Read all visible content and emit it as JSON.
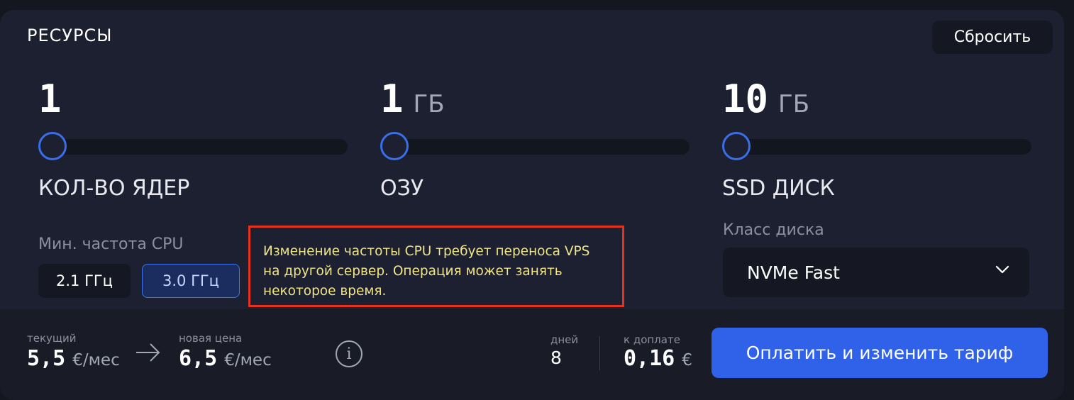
{
  "header": {
    "title": "РЕСУРСЫ",
    "reset_label": "Сбросить"
  },
  "resources": [
    {
      "value": "1",
      "unit": "",
      "label": "КОЛ-ВО ЯДЕР",
      "slider_fraction": 0
    },
    {
      "value": "1",
      "unit": "ГБ",
      "label": "ОЗУ",
      "slider_fraction": 0
    },
    {
      "value": "10",
      "unit": "ГБ",
      "label": "SSD ДИСК",
      "slider_fraction": 0
    }
  ],
  "cpu": {
    "label": "Мин. частота CPU",
    "options": [
      "2.1 ГГц",
      "3.0 ГГц"
    ],
    "selected": "3.0 ГГц"
  },
  "tooltip": {
    "text": "Изменение частоты CPU требует переноса VPS на другой сервер. Операция может занять некоторое время."
  },
  "disk": {
    "label": "Класс диска",
    "selected": "NVMe Fast"
  },
  "footer": {
    "current_label": "текущий",
    "current_value": "5,5",
    "current_unit": "€/мес",
    "new_label": "новая цена",
    "new_value": "6,5",
    "new_unit": "€/мес",
    "info_icon": "i",
    "days_label": "дней",
    "days_value": "8",
    "due_label": "к доплате",
    "due_value": "0,16",
    "due_unit": "€",
    "pay_label": "Оплатить и изменить тариф"
  },
  "colors": {
    "accent": "#2f62e9",
    "slider_handle": "#3a6ee8",
    "tooltip_border": "#e8311f",
    "tooltip_text": "#f0e588"
  }
}
